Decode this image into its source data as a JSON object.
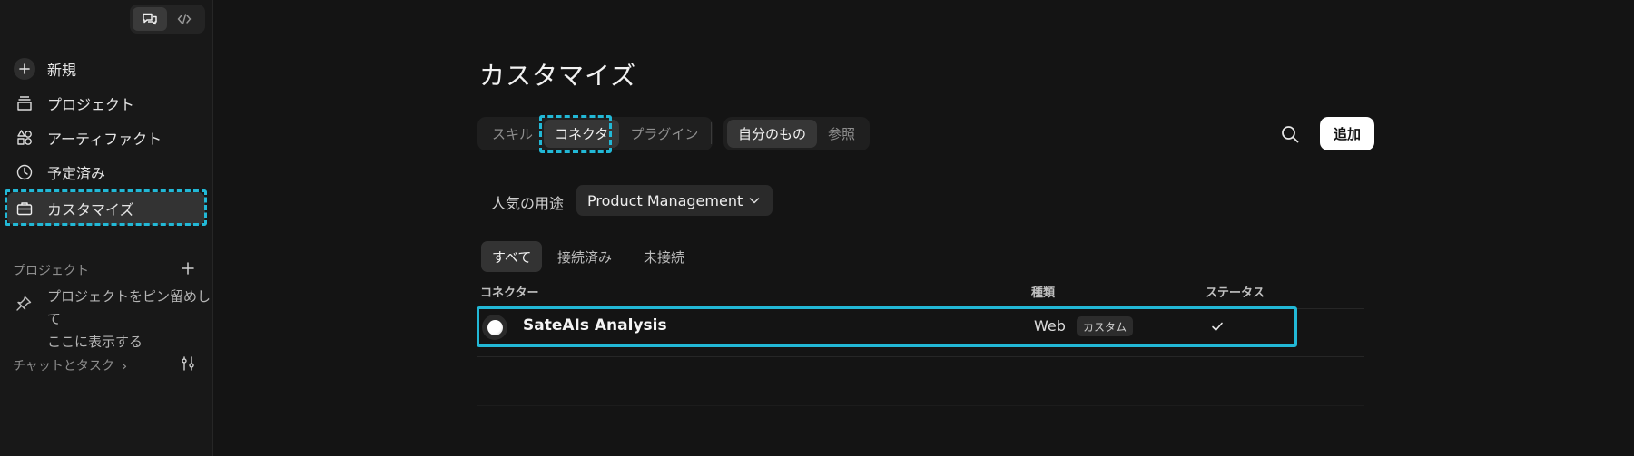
{
  "sidebar": {
    "mode_toggle": {
      "chat_icon": "chat-bubbles-icon",
      "code_icon": "code-brackets-icon"
    },
    "nav": [
      {
        "label": "新規",
        "icon": "plus-icon"
      },
      {
        "label": "プロジェクト",
        "icon": "stack-icon"
      },
      {
        "label": "アーティファクト",
        "icon": "shapes-icon"
      },
      {
        "label": "予定済み",
        "icon": "clock-icon"
      },
      {
        "label": "カスタマイズ",
        "icon": "briefcase-icon"
      }
    ],
    "projects_label": "プロジェクト",
    "pin_hint_line1": "プロジェクトをピン留めして",
    "pin_hint_line2": "ここに表示する",
    "chats_label": "チャットとタスク",
    "chats_chevron": "›"
  },
  "main": {
    "title": "カスタマイズ",
    "tabs": [
      "スキル",
      "コネクタ",
      "プラグイン"
    ],
    "scope_tabs": [
      "自分のもの",
      "参照"
    ],
    "add_label": "追加",
    "usage_label": "人気の用途",
    "usage_value": "Product Management",
    "filters": [
      "すべて",
      "接続済み",
      "未接続"
    ],
    "table": {
      "headers": [
        "コネクター",
        "種類",
        "ステータス"
      ],
      "rows": [
        {
          "name": "SateAIs Analysis",
          "type": "Web",
          "badge": "カスタム",
          "status": "connected"
        }
      ]
    }
  },
  "colors": {
    "highlight": "#22b8d6",
    "background": "#141414",
    "sidebar": "#181818"
  }
}
